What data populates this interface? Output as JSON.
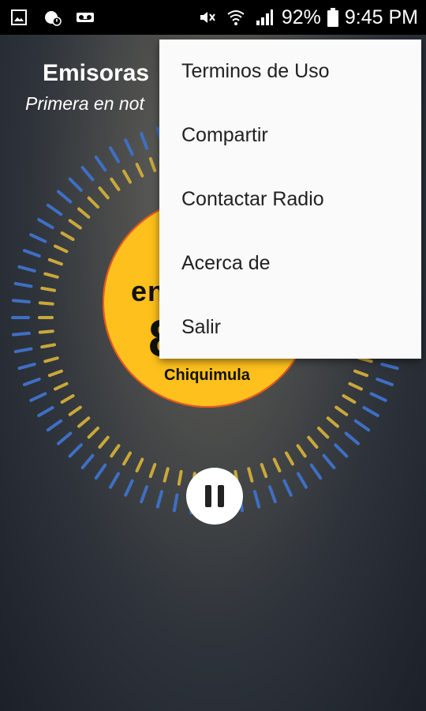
{
  "status_bar": {
    "left_icons": [
      "image-icon",
      "sync-alert-icon",
      "voicemail-icon"
    ],
    "right_icons": [
      "mute-icon",
      "wifi-icon",
      "signal-icon"
    ],
    "battery": "92%",
    "time": "9:45 PM"
  },
  "header": {
    "title": "Emisoras",
    "subtitle": "Primera en not"
  },
  "logo": {
    "brand": "en",
    "frequency": "8",
    "city": "Chiquimula",
    "colors": {
      "fill": "#fdc01c",
      "edge": "#e8551e"
    }
  },
  "player": {
    "button": "pause-icon"
  },
  "visualizer": {
    "colors": [
      "#3f6fc4",
      "#c9a83a"
    ]
  },
  "menu": {
    "items": [
      {
        "label": "Terminos de Uso"
      },
      {
        "label": "Compartir"
      },
      {
        "label": "Contactar Radio"
      },
      {
        "label": "Acerca de"
      },
      {
        "label": "Salir"
      }
    ]
  }
}
